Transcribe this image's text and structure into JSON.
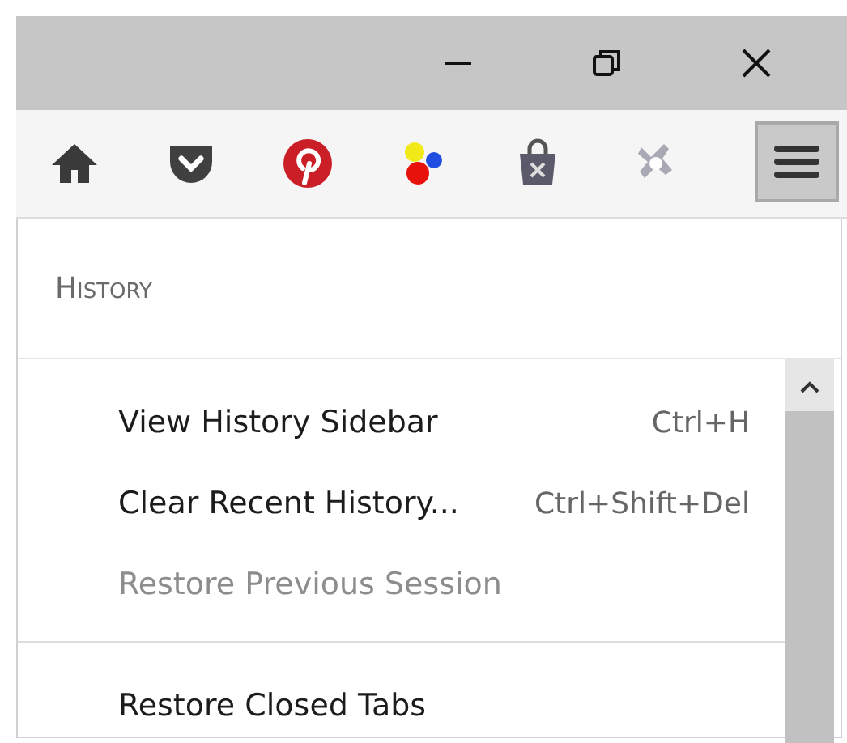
{
  "toolbar": {
    "menu_button": {
      "selected": true
    }
  },
  "panel": {
    "title": "History",
    "items": [
      {
        "kind": "item",
        "label": "View History Sidebar",
        "shortcut": "Ctrl+H",
        "disabled": false
      },
      {
        "kind": "item",
        "label": "Clear Recent History...",
        "shortcut": "Ctrl+Shift+Del",
        "disabled": false
      },
      {
        "kind": "item",
        "label": "Restore Previous Session",
        "disabled": true
      },
      {
        "kind": "separator"
      },
      {
        "kind": "item",
        "label": "Restore Closed Tabs",
        "disabled": false
      }
    ]
  }
}
